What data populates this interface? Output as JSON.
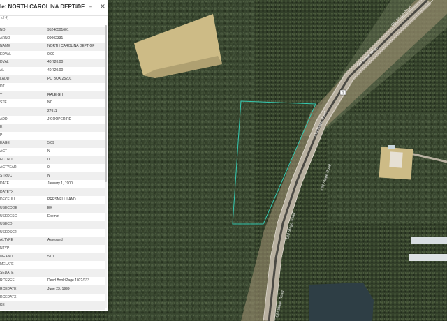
{
  "popup": {
    "title": "le: NORTH CAROLINA DEPT OF",
    "subtitle": "of 4)",
    "rows": [
      {
        "key": "NO",
        "value": "95246501601"
      },
      {
        "key": "ARNO",
        "value": "99002331"
      },
      {
        "key": "NAME",
        "value": "NORTH CAROLINA DEPT OF"
      },
      {
        "key": "EDVAL",
        "value": "0.00"
      },
      {
        "key": "DVAL",
        "value": "40,720.00"
      },
      {
        "key": "AL",
        "value": "40,720.00"
      },
      {
        "key": "LADD",
        "value": "PO BOX 25201"
      },
      {
        "key": "DT",
        "value": ""
      },
      {
        "key": "Y",
        "value": "RALEIGH"
      },
      {
        "key": "STE",
        "value": "NC"
      },
      {
        "key": "",
        "value": "27611"
      },
      {
        "key": "ADD",
        "value": "J COOPER RD"
      },
      {
        "key": "E",
        "value": ""
      },
      {
        "key": "P",
        "value": ""
      },
      {
        "key": "EAGE",
        "value": "5.09"
      },
      {
        "key": "ACT",
        "value": "N"
      },
      {
        "key": "ECTNO",
        "value": "0"
      },
      {
        "key": "ACTYEAR",
        "value": "0"
      },
      {
        "key": "STRUC",
        "value": "N"
      },
      {
        "key": "DATE",
        "value": "January 1, 1900"
      },
      {
        "key": "DATETX",
        "value": ""
      },
      {
        "key": "DECFULL",
        "value": "PRESNELL LAND"
      },
      {
        "key": "USECODE",
        "value": "EX"
      },
      {
        "key": "USEDESC",
        "value": "Exempt"
      },
      {
        "key": "USECD",
        "value": ""
      },
      {
        "key": "USEDSC2",
        "value": ""
      },
      {
        "key": "ALTYPE",
        "value": "Assessed"
      },
      {
        "key": "NTYP",
        "value": ""
      },
      {
        "key": "MEANO",
        "value": "5.01"
      },
      {
        "key": "MELATE",
        "value": ""
      },
      {
        "key": "SEDATE",
        "value": ""
      },
      {
        "key": "RCEREF",
        "value": "Deed Book/Page 1022/333"
      },
      {
        "key": "RCEDATE",
        "value": "June 23, 1999"
      },
      {
        "key": "RCEDATX",
        "value": ""
      },
      {
        "key": "KE",
        "value": ""
      }
    ]
  },
  "map": {
    "road_label": "Old Stage Road",
    "route_shield": "1"
  },
  "colors": {
    "forest": "#2f3a26",
    "field": "#cdbb86",
    "road": "#b9b1a1",
    "highlight": "#35c9b0",
    "water": "#2e3e45"
  }
}
